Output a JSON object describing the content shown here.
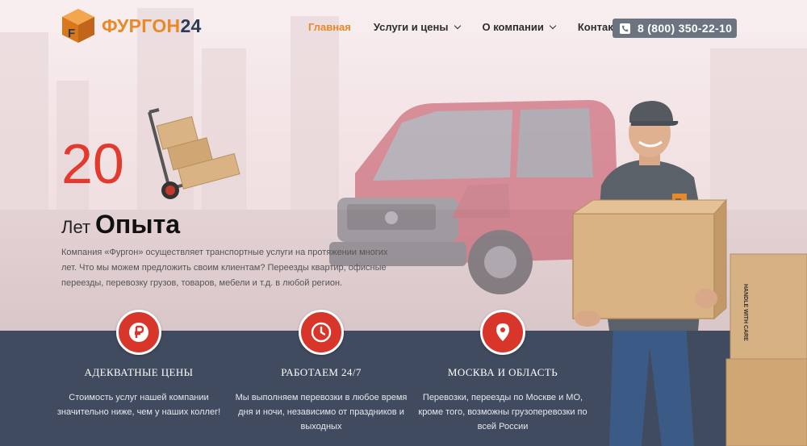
{
  "brand": {
    "name_part1": "ФУРГОН",
    "name_part2": "24",
    "logo_letter": "F"
  },
  "nav": {
    "items": [
      {
        "label": "Главная",
        "active": true,
        "has_dropdown": false
      },
      {
        "label": "Услуги и цены",
        "active": false,
        "has_dropdown": true
      },
      {
        "label": "О компании",
        "active": false,
        "has_dropdown": true
      },
      {
        "label": "Контакты",
        "active": false,
        "has_dropdown": false
      }
    ],
    "phone": "8 (800) 350-22-10"
  },
  "hero": {
    "years_number": "20",
    "years_small": "Лет",
    "years_big": "Опыта",
    "description": "Компания «Фургон» осуществляет транспортные услуги на протяжении многих лет. Что мы можем предложить своим клиентам? Переезды квартир, офисные переезды, перевозку грузов, товаров, мебели и т.д. в любой регион."
  },
  "features": [
    {
      "icon": "ruble-icon",
      "title": "Адекватные цены",
      "text": "Стоимость услуг нашей компании значительно ниже, чем у наших коллег!"
    },
    {
      "icon": "clock-icon",
      "title": "Работаем 24/7",
      "text": "Мы выполняем перевозки в любое время дня и ночи, независимо от праздников и выходных"
    },
    {
      "icon": "map-pin-icon",
      "title": "Москва и область",
      "text": "Перевозки, переезды по Москве и МО, кроме того, возможны грузоперевозки по всей России"
    }
  ],
  "box_label": "HANDLE WITH CARE",
  "colors": {
    "accent_orange": "#e8892a",
    "accent_red": "#d8362b",
    "navy": "#2c3a55",
    "band": "#414b5f",
    "phone_bg": "#6b7480"
  }
}
